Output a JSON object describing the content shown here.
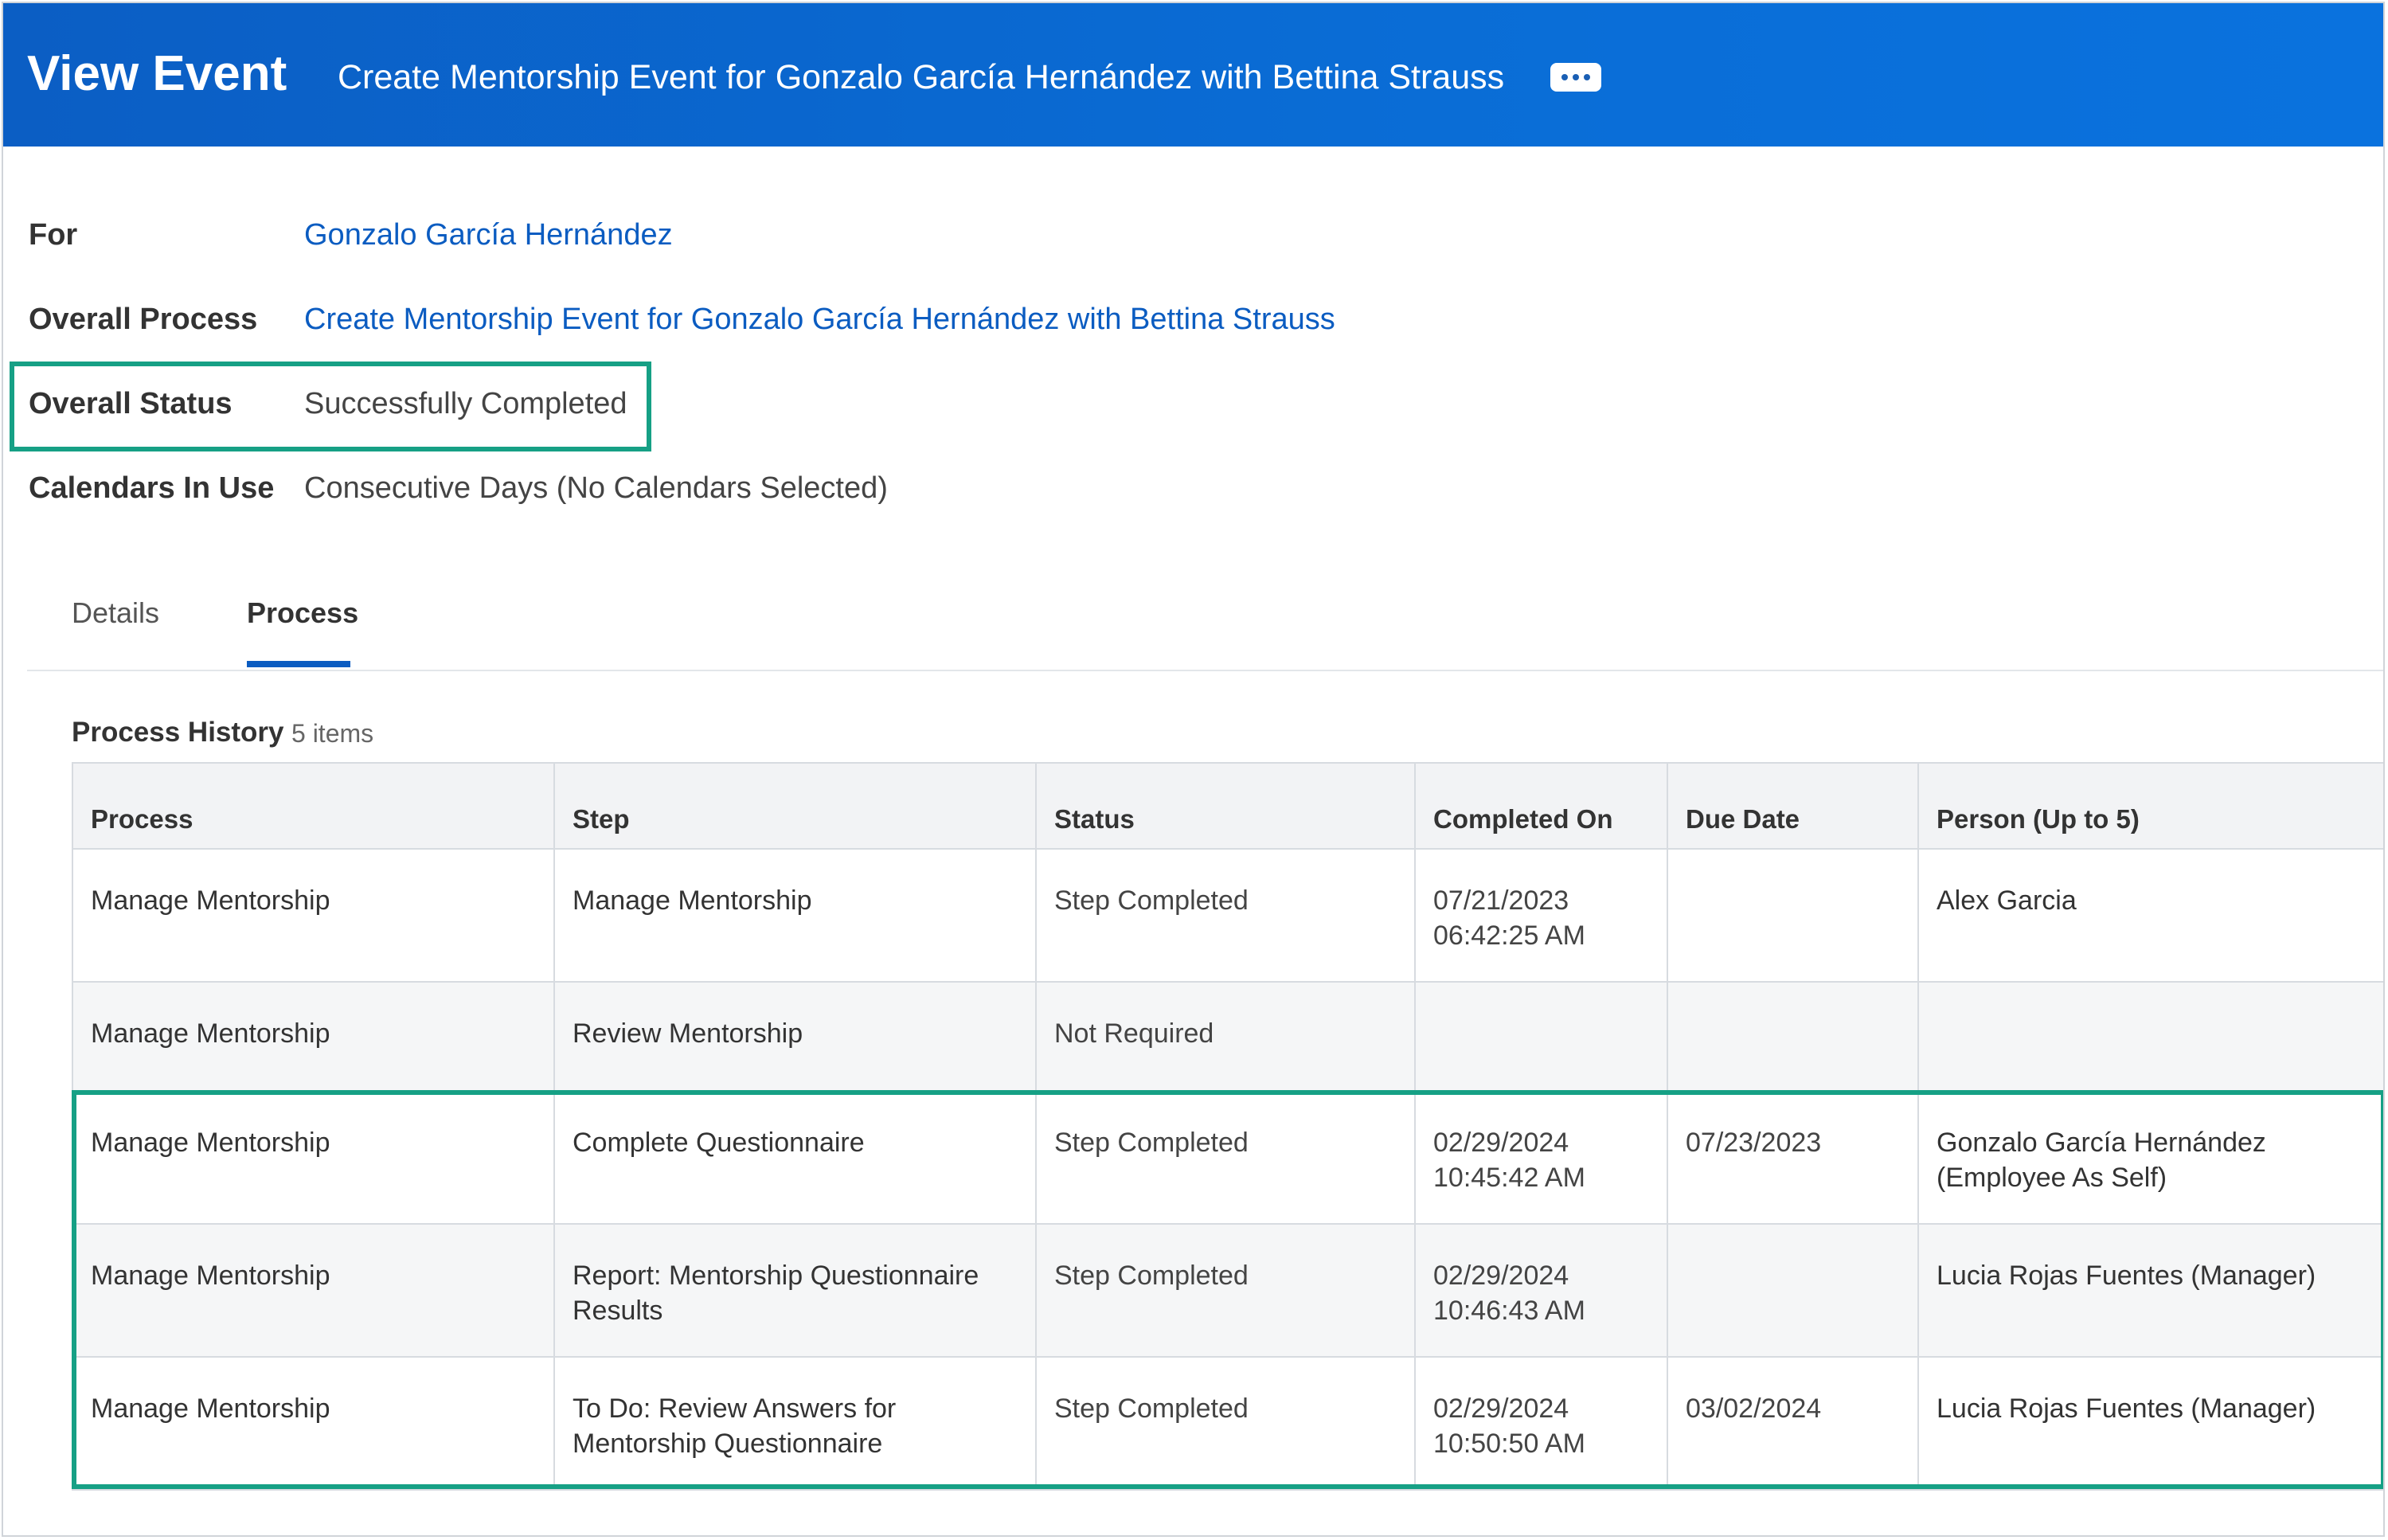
{
  "header": {
    "title": "View Event",
    "subtitle": "Create Mentorship Event for Gonzalo García Hernández with Bettina Strauss",
    "more_icon": "ellipsis-icon"
  },
  "fields": {
    "for_label": "For",
    "for_value": "Gonzalo García Hernández",
    "process_label": "Overall Process",
    "process_value": "Create Mentorship Event for Gonzalo García Hernández with Bettina Strauss",
    "status_label": "Overall Status",
    "status_value": "Successfully Completed",
    "calendars_label": "Calendars In Use",
    "calendars_value": "Consecutive Days (No Calendars Selected)"
  },
  "tabs": [
    {
      "label": "Details",
      "active": false
    },
    {
      "label": "Process",
      "active": true
    }
  ],
  "history": {
    "title": "Process History",
    "count": "5 items",
    "columns": [
      "Process",
      "Step",
      "Status",
      "Completed On",
      "Due Date",
      "Person (Up to 5)"
    ],
    "rows": [
      {
        "process": "Manage Mentorship",
        "step": "Manage Mentorship",
        "status": "Step Completed",
        "completed_date": "07/21/2023",
        "completed_time": "06:42:25 AM",
        "due": "",
        "person": "Alex Garcia"
      },
      {
        "process": "Manage Mentorship",
        "step": "Review Mentorship",
        "status": "Not Required",
        "completed_date": "",
        "completed_time": "",
        "due": "",
        "person": ""
      },
      {
        "process": "Manage Mentorship",
        "step": "Complete Questionnaire",
        "status": "Step Completed",
        "completed_date": "02/29/2024",
        "completed_time": "10:45:42 AM",
        "due": "07/23/2023",
        "person": "Gonzalo García Hernández (Employee As Self)"
      },
      {
        "process": "Manage Mentorship",
        "step": "Report: Mentorship Questionnaire Results",
        "status": "Step Completed",
        "completed_date": "02/29/2024",
        "completed_time": "10:46:43 AM",
        "due": "",
        "person": "Lucia Rojas Fuentes (Manager)"
      },
      {
        "process": "Manage Mentorship",
        "step": "To Do: Review Answers for Mentorship Questionnaire",
        "status": "Step Completed",
        "completed_date": "02/29/2024",
        "completed_time": "10:50:50 AM",
        "due": "03/02/2024",
        "person": "Lucia Rojas Fuentes (Manager)"
      }
    ]
  },
  "colors": {
    "header_blue": "#0b5ec4",
    "link_blue": "#0b5cc1",
    "highlight_green": "#16a085"
  }
}
